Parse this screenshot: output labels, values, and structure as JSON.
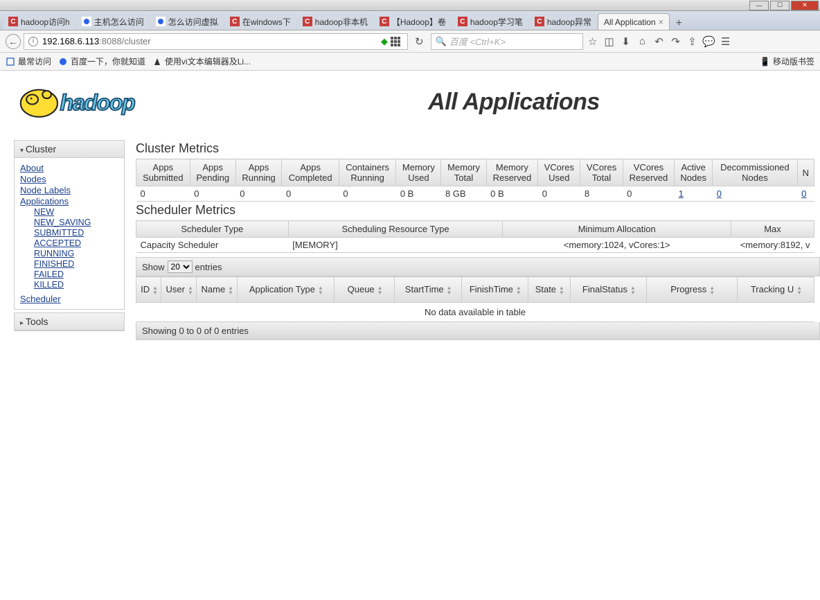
{
  "titlebar": {
    "min": "—",
    "max": "☐",
    "close": "✕"
  },
  "tabs": [
    {
      "label": "hadoop访问h",
      "icon": "red"
    },
    {
      "label": "主机怎么访问",
      "icon": "baidu"
    },
    {
      "label": "怎么访问虚拟",
      "icon": "baidu"
    },
    {
      "label": "在windows下",
      "icon": "red"
    },
    {
      "label": "hadoop非本机",
      "icon": "red"
    },
    {
      "label": "【Hadoop】卷",
      "icon": "red"
    },
    {
      "label": "hadoop学习笔",
      "icon": "red"
    },
    {
      "label": "hadoop异常",
      "icon": "red"
    },
    {
      "label": "All Application",
      "icon": "none",
      "active": true
    }
  ],
  "url": {
    "host": "192.168.6.113",
    "port": ":8088",
    "path": "/cluster"
  },
  "search_placeholder": "百度 <Ctrl+K>",
  "bookmarks": {
    "b1": "最常访问",
    "b2": "百度一下，你就知道",
    "b3": "使用vi文本编辑器及Li...",
    "mob": "移动版书签"
  },
  "page_title": "All Applications",
  "sidebar": {
    "cluster_head": "Cluster",
    "tools_head": "Tools",
    "links": {
      "about": "About",
      "nodes": "Nodes",
      "node_labels": "Node Labels",
      "applications": "Applications",
      "new": "NEW",
      "new_saving": "NEW_SAVING",
      "submitted": "SUBMITTED",
      "accepted": "ACCEPTED",
      "running": "RUNNING",
      "finished": "FINISHED",
      "failed": "FAILED",
      "killed": "KILLED",
      "scheduler": "Scheduler"
    }
  },
  "cluster_metrics_head": "Cluster Metrics",
  "cm_headers": [
    "Apps Submitted",
    "Apps Pending",
    "Apps Running",
    "Apps Completed",
    "Containers Running",
    "Memory Used",
    "Memory Total",
    "Memory Reserved",
    "VCores Used",
    "VCores Total",
    "VCores Reserved",
    "Active Nodes",
    "Decommissioned Nodes",
    "N"
  ],
  "cm_values": [
    "0",
    "0",
    "0",
    "0",
    "0",
    "0 B",
    "8 GB",
    "0 B",
    "0",
    "8",
    "0",
    "1",
    "0",
    "0"
  ],
  "scheduler_metrics_head": "Scheduler Metrics",
  "sm_headers": [
    "Scheduler Type",
    "Scheduling Resource Type",
    "Minimum Allocation",
    "Max"
  ],
  "sm_values": [
    "Capacity Scheduler",
    "[MEMORY]",
    "<memory:1024, vCores:1>",
    "<memory:8192, v"
  ],
  "show_label": "Show",
  "show_value": "20",
  "entries_label": "entries",
  "app_headers": [
    "ID",
    "User",
    "Name",
    "Application Type",
    "Queue",
    "StartTime",
    "FinishTime",
    "State",
    "FinalStatus",
    "Progress",
    "Tracking U"
  ],
  "nodata": "No data available in table",
  "showing": "Showing 0 to 0 of 0 entries"
}
